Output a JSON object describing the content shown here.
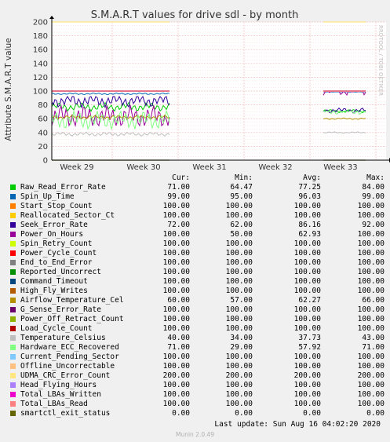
{
  "chart_data": {
    "type": "line",
    "title": "S.M.A.R.T values for drive sdl - by month",
    "ylabel": "Attribute S.M.A.R.T value",
    "watermark": "RRDTOOL / TOBI OETIKER",
    "ylim": [
      0,
      200
    ],
    "yticks": [
      "0",
      "20",
      "40",
      "60",
      "80",
      "100",
      "120",
      "140",
      "160",
      "180",
      "200"
    ],
    "xticks": [
      "Week 29",
      "Week 30",
      "Week 31",
      "Week 32",
      "Week 33"
    ],
    "gap": "Week 30 to Week 33 (no data)",
    "columns": [
      "Cur:",
      "Min:",
      "Avg:",
      "Max:"
    ],
    "series": [
      {
        "name": "Raw_Read_Error_Rate",
        "color": "#00cc00",
        "cur": "71.00",
        "min": "64.47",
        "avg": "77.25",
        "max": "84.00"
      },
      {
        "name": "Spin_Up_Time",
        "color": "#0066b3",
        "cur": "99.00",
        "min": "95.00",
        "avg": "96.03",
        "max": "99.00"
      },
      {
        "name": "Start_Stop_Count",
        "color": "#ff8000",
        "cur": "100.00",
        "min": "100.00",
        "avg": "100.00",
        "max": "100.00"
      },
      {
        "name": "Reallocated_Sector_Ct",
        "color": "#ffcc00",
        "cur": "100.00",
        "min": "100.00",
        "avg": "100.00",
        "max": "100.00"
      },
      {
        "name": "Seek_Error_Rate",
        "color": "#330099",
        "cur": "72.00",
        "min": "62.00",
        "avg": "86.16",
        "max": "92.00"
      },
      {
        "name": "Power_On_Hours",
        "color": "#990099",
        "cur": "100.00",
        "min": "50.00",
        "avg": "62.93",
        "max": "100.00"
      },
      {
        "name": "Spin_Retry_Count",
        "color": "#ccff00",
        "cur": "100.00",
        "min": "100.00",
        "avg": "100.00",
        "max": "100.00"
      },
      {
        "name": "Power_Cycle_Count",
        "color": "#ff0000",
        "cur": "100.00",
        "min": "100.00",
        "avg": "100.00",
        "max": "100.00"
      },
      {
        "name": "End_to_End_Error",
        "color": "#808080",
        "cur": "100.00",
        "min": "100.00",
        "avg": "100.00",
        "max": "100.00"
      },
      {
        "name": "Reported_Uncorrect",
        "color": "#008f00",
        "cur": "100.00",
        "min": "100.00",
        "avg": "100.00",
        "max": "100.00"
      },
      {
        "name": "Command_Timeout",
        "color": "#00487d",
        "cur": "100.00",
        "min": "100.00",
        "avg": "100.00",
        "max": "100.00"
      },
      {
        "name": "High_Fly_Writes",
        "color": "#b35a00",
        "cur": "100.00",
        "min": "100.00",
        "avg": "100.00",
        "max": "100.00"
      },
      {
        "name": "Airflow_Temperature_Cel",
        "color": "#b38f00",
        "cur": "60.00",
        "min": "57.00",
        "avg": "62.27",
        "max": "66.00"
      },
      {
        "name": "G_Sense_Error_Rate",
        "color": "#6b006b",
        "cur": "100.00",
        "min": "100.00",
        "avg": "100.00",
        "max": "100.00"
      },
      {
        "name": "Power_Off_Retract_Count",
        "color": "#8fb300",
        "cur": "100.00",
        "min": "100.00",
        "avg": "100.00",
        "max": "100.00"
      },
      {
        "name": "Load_Cycle_Count",
        "color": "#b30000",
        "cur": "100.00",
        "min": "100.00",
        "avg": "100.00",
        "max": "100.00"
      },
      {
        "name": "Temperature_Celsius",
        "color": "#bebebe",
        "cur": "40.00",
        "min": "34.00",
        "avg": "37.73",
        "max": "43.00"
      },
      {
        "name": "Hardware_ECC_Recovered",
        "color": "#80ff80",
        "cur": "71.00",
        "min": "29.00",
        "avg": "57.92",
        "max": "71.00"
      },
      {
        "name": "Current_Pending_Sector",
        "color": "#80c9ff",
        "cur": "100.00",
        "min": "100.00",
        "avg": "100.00",
        "max": "100.00"
      },
      {
        "name": "Offline_Uncorrectable",
        "color": "#ffc080",
        "cur": "100.00",
        "min": "100.00",
        "avg": "100.00",
        "max": "100.00"
      },
      {
        "name": "UDMA_CRC_Error_Count",
        "color": "#ffe680",
        "cur": "200.00",
        "min": "200.00",
        "avg": "200.00",
        "max": "200.00"
      },
      {
        "name": "Head_Flying_Hours",
        "color": "#aa80ff",
        "cur": "100.00",
        "min": "100.00",
        "avg": "100.00",
        "max": "100.00"
      },
      {
        "name": "Total_LBAs_Written",
        "color": "#ee00cc",
        "cur": "100.00",
        "min": "100.00",
        "avg": "100.00",
        "max": "100.00"
      },
      {
        "name": "Total_LBAs_Read",
        "color": "#ff8080",
        "cur": "100.00",
        "min": "100.00",
        "avg": "100.00",
        "max": "100.00"
      },
      {
        "name": "smartctl_exit_status",
        "color": "#666600",
        "cur": "0.00",
        "min": "0.00",
        "avg": "0.00",
        "max": "0.00"
      }
    ]
  },
  "last_update": "Last update: Sun Aug 16 04:02:20 2020",
  "footer": "Munin 2.0.49"
}
